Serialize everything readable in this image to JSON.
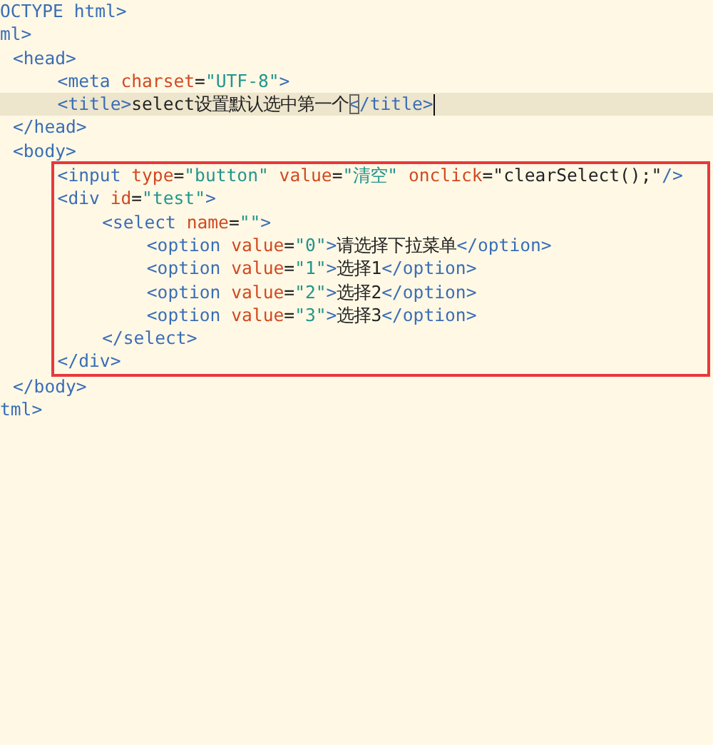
{
  "editor": {
    "lines": [
      {
        "current": false,
        "boxed": false,
        "tokens": [
          {
            "kind": "tag",
            "text": "OCTYPE html>"
          }
        ]
      },
      {
        "current": false,
        "boxed": false,
        "tokens": [
          {
            "kind": "tag",
            "text": "ml>"
          }
        ],
        "children": [
          {
            "current": false,
            "boxed": false,
            "tokens": [
              {
                "kind": "tag",
                "text": "<head>"
              }
            ],
            "children": [
              {
                "current": false,
                "boxed": false,
                "tokens": [
                  {
                    "kind": "tag",
                    "text": "<meta "
                  },
                  {
                    "kind": "attr",
                    "text": "charset"
                  },
                  {
                    "kind": "text",
                    "text": "="
                  },
                  {
                    "kind": "str",
                    "text": "\"UTF-8\""
                  },
                  {
                    "kind": "tag",
                    "text": ">"
                  }
                ]
              },
              {
                "current": true,
                "boxed": false,
                "tokens": [
                  {
                    "kind": "tag",
                    "text": "<title>"
                  },
                  {
                    "kind": "text",
                    "text": "select设置默认选中第一个"
                  },
                  {
                    "kind": "bracket_match",
                    "text": "<"
                  },
                  {
                    "kind": "tag",
                    "text": "/title>"
                  }
                ]
              }
            ]
          },
          {
            "current": false,
            "boxed": false,
            "tokens": [
              {
                "kind": "tag",
                "text": "</head>"
              }
            ]
          },
          {
            "current": false,
            "boxed": false,
            "tokens": [
              {
                "kind": "tag",
                "text": "<body>"
              }
            ],
            "children": [
              {
                "current": false,
                "boxed": true,
                "tokens": [
                  {
                    "kind": "tag",
                    "text": "<input "
                  },
                  {
                    "kind": "attr",
                    "text": "type"
                  },
                  {
                    "kind": "text",
                    "text": "="
                  },
                  {
                    "kind": "str",
                    "text": "\"button\" "
                  },
                  {
                    "kind": "attr",
                    "text": "value"
                  },
                  {
                    "kind": "text",
                    "text": "="
                  },
                  {
                    "kind": "str",
                    "text": "\"清空\" "
                  },
                  {
                    "kind": "attr",
                    "text": "onclick"
                  },
                  {
                    "kind": "text",
                    "text": "=\"clearSelect();\""
                  },
                  {
                    "kind": "tag",
                    "text": "/>"
                  }
                ]
              },
              {
                "current": false,
                "boxed": true,
                "tokens": [
                  {
                    "kind": "tag",
                    "text": "<div "
                  },
                  {
                    "kind": "attr",
                    "text": "id"
                  },
                  {
                    "kind": "text",
                    "text": "="
                  },
                  {
                    "kind": "str",
                    "text": "\"test\""
                  },
                  {
                    "kind": "tag",
                    "text": ">"
                  }
                ],
                "children": [
                  {
                    "current": false,
                    "boxed": true,
                    "tokens": [
                      {
                        "kind": "tag",
                        "text": "<select "
                      },
                      {
                        "kind": "attr",
                        "text": "name"
                      },
                      {
                        "kind": "text",
                        "text": "="
                      },
                      {
                        "kind": "str",
                        "text": "\"\""
                      },
                      {
                        "kind": "tag",
                        "text": ">"
                      }
                    ],
                    "children": [
                      {
                        "current": false,
                        "boxed": true,
                        "tokens": [
                          {
                            "kind": "tag",
                            "text": "<option "
                          },
                          {
                            "kind": "attr",
                            "text": "value"
                          },
                          {
                            "kind": "text",
                            "text": "="
                          },
                          {
                            "kind": "str",
                            "text": "\"0\""
                          },
                          {
                            "kind": "tag",
                            "text": ">"
                          },
                          {
                            "kind": "text",
                            "text": "请选择下拉菜单"
                          },
                          {
                            "kind": "tag",
                            "text": "</option>"
                          }
                        ]
                      },
                      {
                        "current": false,
                        "boxed": true,
                        "tokens": [
                          {
                            "kind": "tag",
                            "text": "<option "
                          },
                          {
                            "kind": "attr",
                            "text": "value"
                          },
                          {
                            "kind": "text",
                            "text": "="
                          },
                          {
                            "kind": "str",
                            "text": "\"1\""
                          },
                          {
                            "kind": "tag",
                            "text": ">"
                          },
                          {
                            "kind": "text",
                            "text": "选择1"
                          },
                          {
                            "kind": "tag",
                            "text": "</option>"
                          }
                        ]
                      },
                      {
                        "current": false,
                        "boxed": true,
                        "tokens": [
                          {
                            "kind": "tag",
                            "text": "<option "
                          },
                          {
                            "kind": "attr",
                            "text": "value"
                          },
                          {
                            "kind": "text",
                            "text": "="
                          },
                          {
                            "kind": "str",
                            "text": "\"2\""
                          },
                          {
                            "kind": "tag",
                            "text": ">"
                          },
                          {
                            "kind": "text",
                            "text": "选择2"
                          },
                          {
                            "kind": "tag",
                            "text": "</option>"
                          }
                        ]
                      },
                      {
                        "current": false,
                        "boxed": true,
                        "tokens": [
                          {
                            "kind": "tag",
                            "text": "<option "
                          },
                          {
                            "kind": "attr",
                            "text": "value"
                          },
                          {
                            "kind": "text",
                            "text": "="
                          },
                          {
                            "kind": "str",
                            "text": "\"3\""
                          },
                          {
                            "kind": "tag",
                            "text": ">"
                          },
                          {
                            "kind": "text",
                            "text": "选择3"
                          },
                          {
                            "kind": "tag",
                            "text": "</option>"
                          }
                        ]
                      }
                    ]
                  },
                  {
                    "current": false,
                    "boxed": true,
                    "tokens": [
                      {
                        "kind": "tag",
                        "text": "</select>"
                      }
                    ]
                  }
                ]
              },
              {
                "current": false,
                "boxed": true,
                "tokens": [
                  {
                    "kind": "tag",
                    "text": "</div>"
                  }
                ]
              }
            ]
          },
          {
            "current": false,
            "boxed": false,
            "tokens": [
              {
                "kind": "tag",
                "text": "</body>"
              }
            ]
          }
        ]
      },
      {
        "current": false,
        "boxed": false,
        "tokens": [
          {
            "kind": "tag",
            "text": "tml>"
          }
        ]
      }
    ]
  }
}
